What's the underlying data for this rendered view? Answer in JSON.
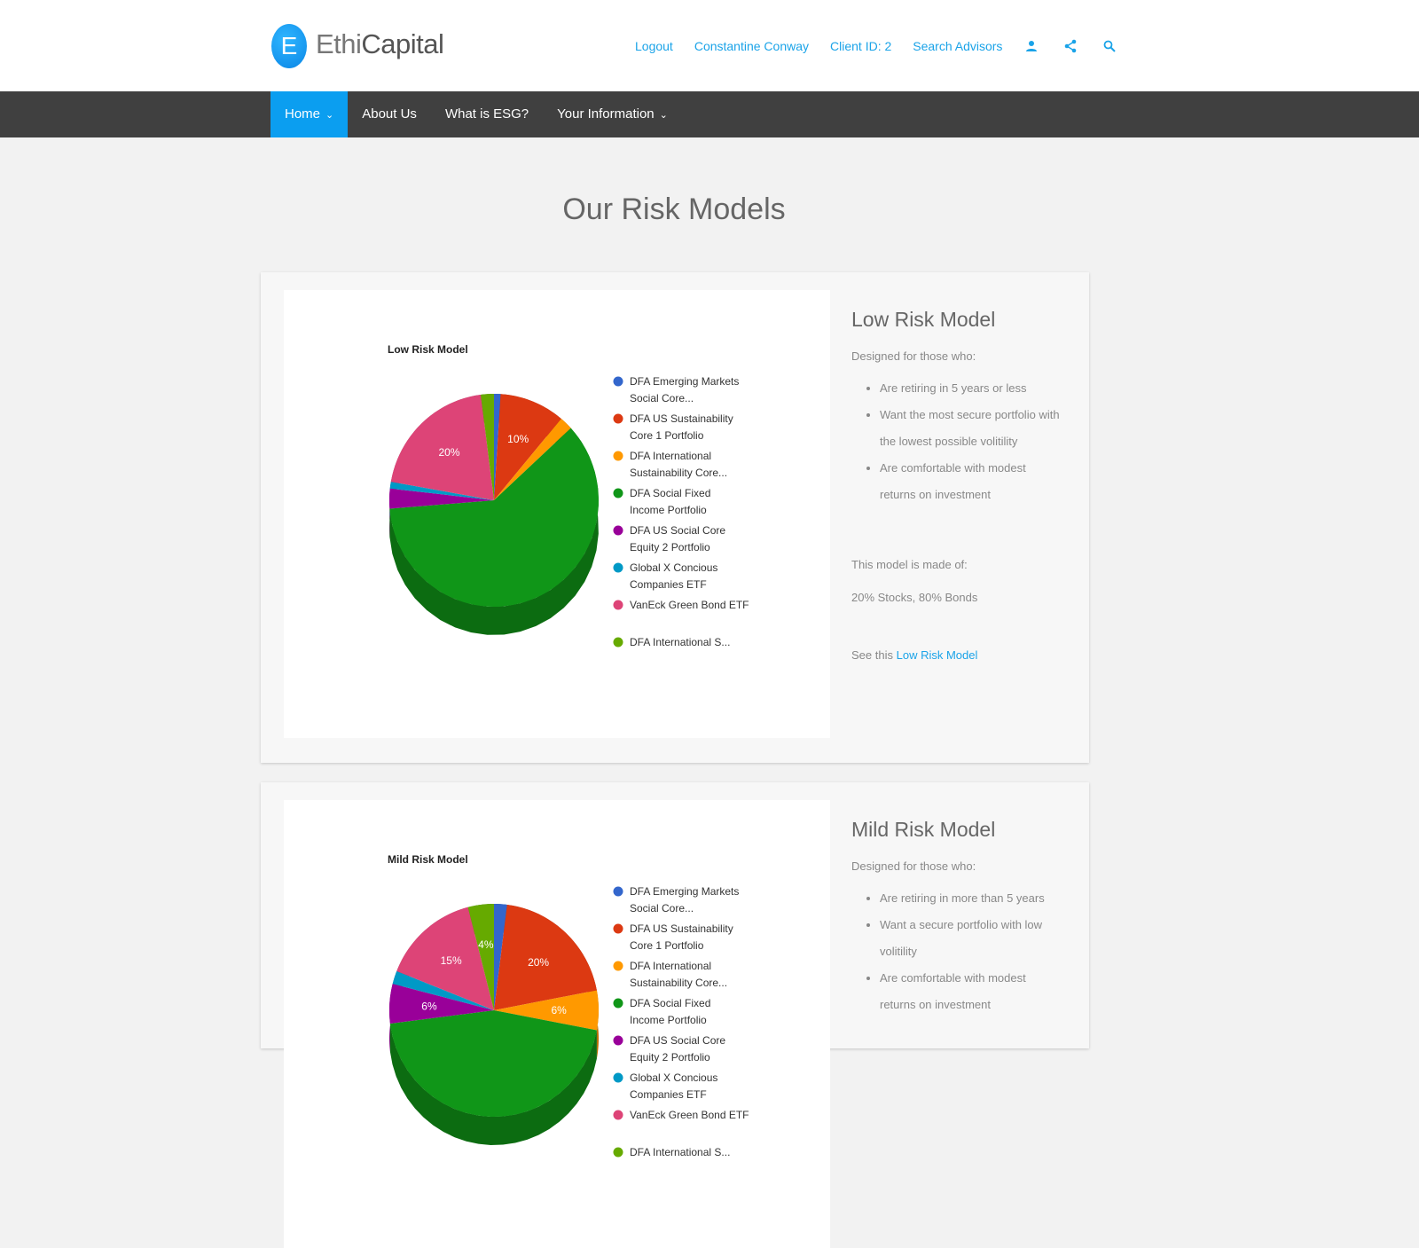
{
  "header": {
    "logo_letter": "E",
    "logo_light": "Ethi",
    "logo_bold": "Capital",
    "links": [
      "Logout",
      "Constantine Conway",
      "Client ID: 2",
      "Search Advisors"
    ],
    "icons": [
      "user-icon",
      "share-icon",
      "search-icon"
    ],
    "accent_color": "#1aa3e8"
  },
  "nav": {
    "items": [
      {
        "label": "Home",
        "dropdown": true,
        "active": true
      },
      {
        "label": "About Us",
        "dropdown": false,
        "active": false
      },
      {
        "label": "What is ESG?",
        "dropdown": false,
        "active": false
      },
      {
        "label": "Your Information",
        "dropdown": true,
        "active": false
      }
    ],
    "active_color": "#0b9ef0",
    "bar_color": "#404040"
  },
  "page": {
    "title": "Our Risk Models"
  },
  "models": [
    {
      "name": "Low Risk Model",
      "designed_for_label": "Designed for those who:",
      "bullets": [
        "Are retiring in 5 years or less",
        "Want the most secure portfolio with the lowest possible volitility",
        "Are comfortable with modest returns on investment"
      ],
      "made_of_label": "This model is made of:",
      "made_of_value": "20% Stocks, 80% Bonds",
      "see_prefix": "See this",
      "see_link": "Low Risk Model"
    },
    {
      "name": "Mild Risk Model",
      "designed_for_label": "Designed for those who:",
      "bullets": [
        "Are retiring in more than 5 years",
        "Want a secure portfolio with low volitility",
        "Are comfortable with modest returns on investment"
      ]
    }
  ],
  "chart_data": [
    {
      "type": "pie",
      "title": "Low Risk Model",
      "legend": "right",
      "slices": [
        {
          "label": "DFA Emerging Markets Social Core...",
          "value": 1,
          "color": "#3366cc"
        },
        {
          "label": "DFA US Sustainability Core 1 Portfolio",
          "value": 10,
          "color": "#dc3912"
        },
        {
          "label": "DFA International Sustainability Core...",
          "value": 2,
          "color": "#ff9900"
        },
        {
          "label": "DFA Social Fixed Income Portfolio",
          "value": 60,
          "color": "#109618"
        },
        {
          "label": "DFA US Social Core Equity 2 Portfolio",
          "value": 3,
          "color": "#990099"
        },
        {
          "label": "Global X Concious Companies ETF",
          "value": 1,
          "color": "#0099c6"
        },
        {
          "label": "VanEck Green Bond ETF",
          "value": 20,
          "color": "#dd4477"
        },
        {
          "label": "DFA International S...",
          "value": 2,
          "color": "#66aa00"
        }
      ],
      "data_labels": [
        "10%",
        "60%",
        "20%"
      ]
    },
    {
      "type": "pie",
      "title": "Mild Risk Model",
      "legend": "right",
      "slices": [
        {
          "label": "DFA Emerging Markets Social Core...",
          "value": 2,
          "color": "#3366cc"
        },
        {
          "label": "DFA US Sustainability Core 1 Portfolio",
          "value": 20,
          "color": "#dc3912"
        },
        {
          "label": "DFA International Sustainability Core...",
          "value": 6,
          "color": "#ff9900"
        },
        {
          "label": "DFA Social Fixed Income Portfolio",
          "value": 45,
          "color": "#109618"
        },
        {
          "label": "DFA US Social Core Equity 2 Portfolio",
          "value": 6,
          "color": "#990099"
        },
        {
          "label": "Global X Concious Companies ETF",
          "value": 2,
          "color": "#0099c6"
        },
        {
          "label": "VanEck Green Bond ETF",
          "value": 15,
          "color": "#dd4477"
        },
        {
          "label": "DFA International S...",
          "value": 4,
          "color": "#66aa00"
        }
      ],
      "data_labels": [
        "4%",
        "20%",
        "6%",
        "15%",
        "6%"
      ]
    }
  ]
}
